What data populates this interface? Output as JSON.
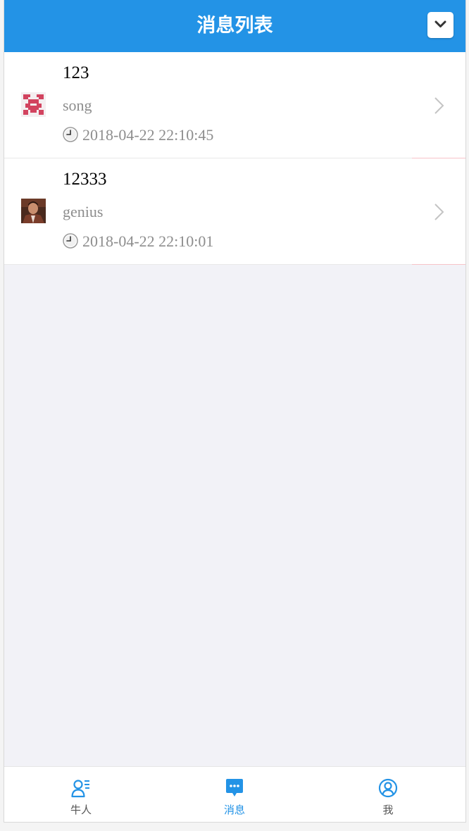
{
  "header": {
    "title": "消息列表"
  },
  "messages": [
    {
      "title": "123",
      "user": "song",
      "time": "2018-04-22 22:10:45"
    },
    {
      "title": "12333",
      "user": "genius",
      "time": "2018-04-22 22:10:01"
    }
  ],
  "tabbar": {
    "tabs": [
      {
        "label": "牛人",
        "icon": "person-list-icon",
        "active": false
      },
      {
        "label": "消息",
        "icon": "chat-bubble-icon",
        "active": true
      },
      {
        "label": "我",
        "icon": "user-circle-icon",
        "active": false
      }
    ]
  },
  "colors": {
    "brand": "#2393e6",
    "secondary_text": "#8d8d8d",
    "background": "#f2f2f7"
  }
}
